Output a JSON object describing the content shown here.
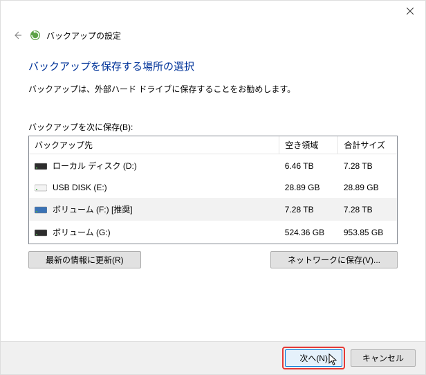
{
  "window": {
    "appname": "バックアップの設定"
  },
  "heading": "バックアップを保存する場所の選択",
  "subtext": "バックアップは、外部ハード ドライブに保存することをお勧めします。",
  "listlabel": "バックアップを次に保存(B):",
  "columns": {
    "destination": "バックアップ先",
    "free": "空き領域",
    "total": "合計サイズ"
  },
  "drives": [
    {
      "name": "ローカル ディスク (D:)",
      "free": "6.46 TB",
      "total": "7.28 TB",
      "color": "#2d2d2d",
      "selected": false
    },
    {
      "name": "USB DISK (E:)",
      "free": "28.89 GB",
      "total": "28.89 GB",
      "color": "#f4f4f4",
      "selected": false
    },
    {
      "name": "ボリューム (F:) [推奨]",
      "free": "7.28 TB",
      "total": "7.28 TB",
      "color": "#3a72b5",
      "selected": true
    },
    {
      "name": "ボリューム (G:)",
      "free": "524.36 GB",
      "total": "953.85 GB",
      "color": "#2d2d2d",
      "selected": false
    }
  ],
  "buttons": {
    "refresh": "最新の情報に更新(R)",
    "network": "ネットワークに保存(V)...",
    "next": "次へ(N)",
    "cancel": "キャンセル"
  }
}
